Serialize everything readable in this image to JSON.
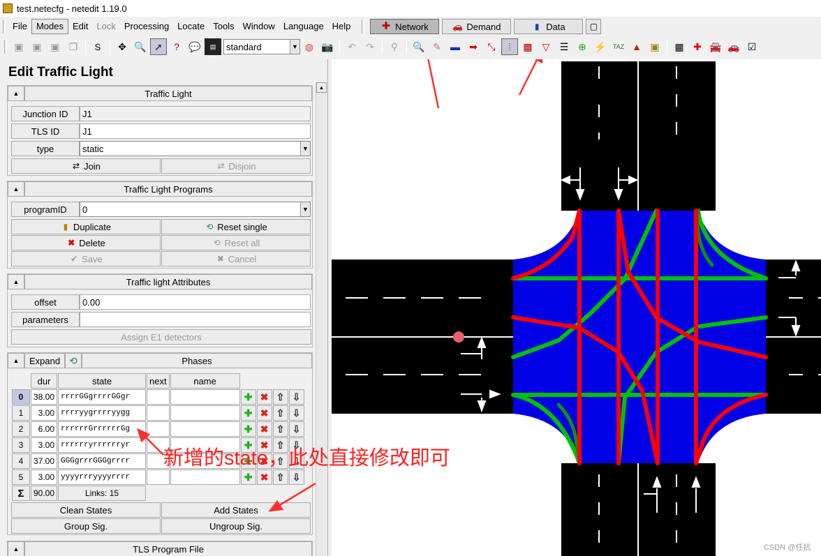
{
  "window": {
    "title": "test.netecfg - netedit 1.19.0",
    "icon": "netedit-logo-icon"
  },
  "menu": {
    "items": [
      {
        "label": "File",
        "disabled": false
      },
      {
        "label": "Modes",
        "disabled": false
      },
      {
        "label": "Edit",
        "disabled": false
      },
      {
        "label": "Lock",
        "disabled": true
      },
      {
        "label": "Processing",
        "disabled": false
      },
      {
        "label": "Locate",
        "disabled": false
      },
      {
        "label": "Tools",
        "disabled": false
      },
      {
        "label": "Window",
        "disabled": false
      },
      {
        "label": "Language",
        "disabled": false
      },
      {
        "label": "Help",
        "disabled": false
      }
    ]
  },
  "supermodes": [
    {
      "label": "Network",
      "icon": "network-icon",
      "active": true
    },
    {
      "label": "Demand",
      "icon": "demand-icon",
      "active": false
    },
    {
      "label": "Data",
      "icon": "data-icon",
      "active": false
    }
  ],
  "toolbar": {
    "s_label": "S",
    "scheme_value": "standard"
  },
  "panel": {
    "title": "Edit Traffic Light",
    "traffic_light": {
      "header": "Traffic Light",
      "junction_label": "Junction ID",
      "junction_value": "J1",
      "tls_label": "TLS ID",
      "tls_value": "J1",
      "type_label": "type",
      "type_value": "static",
      "join_label": "Join",
      "disjoin_label": "Disjoin"
    },
    "programs": {
      "header": "Traffic Light Programs",
      "program_label": "programID",
      "program_value": "0",
      "duplicate_label": "Duplicate",
      "reset_single_label": "Reset single",
      "delete_label": "Delete",
      "reset_all_label": "Reset all",
      "save_label": "Save",
      "cancel_label": "Cancel"
    },
    "attributes": {
      "header": "Traffic light Attributes",
      "offset_label": "offset",
      "offset_value": "0.00",
      "parameters_label": "parameters",
      "parameters_value": "",
      "assign_label": "Assign E1 detectors"
    },
    "phases": {
      "expand_label": "Expand",
      "header": "Phases",
      "columns": {
        "dur": "dur",
        "state": "state",
        "next": "next",
        "name": "name"
      },
      "rows": [
        {
          "index": "0",
          "dur": "38.00",
          "state": "rrrrGGgrrrrGGgr"
        },
        {
          "index": "1",
          "dur": "3.00",
          "state": "rrrryygrrrryygg"
        },
        {
          "index": "2",
          "dur": "6.00",
          "state": "rrrrrrGrrrrrrGg"
        },
        {
          "index": "3",
          "dur": "3.00",
          "state": "rrrrrryrrrrrryr"
        },
        {
          "index": "4",
          "dur": "37.00",
          "state": "GGGgrrrGGGgrrrr"
        },
        {
          "index": "5",
          "dur": "3.00",
          "state": "yyyyrrryyyyrrrr"
        }
      ],
      "sum_symbol": "Σ",
      "total_dur": "90.00",
      "links_text": "Links: 15",
      "clean_states_label": "Clean States",
      "add_states_label": "Add States",
      "group_sig_label": "Group Sig.",
      "ungroup_sig_label": "Ungroup Sig."
    },
    "tls_file": {
      "header": "TLS Program File"
    }
  },
  "annotation": {
    "text": "新增的state，此处直接修改即可",
    "color": "#ff2020"
  },
  "watermark": "CSDN @任抗",
  "colors": {
    "junction": "#0000e6",
    "road": "#000000",
    "signal_red": "#ff0000",
    "signal_green": "#00c000",
    "dark_green": "#109010",
    "marker": "#e86070"
  }
}
